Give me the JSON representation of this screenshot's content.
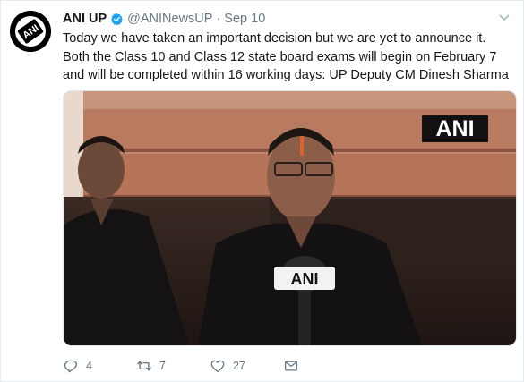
{
  "author": {
    "name": "ANI UP",
    "handle": "@ANINewsUP",
    "time": "Sep 10",
    "separator": "·"
  },
  "tweet": {
    "text": "Today we have taken an important decision but we are yet to announce it. Both the Class 10 and Class 12 state board exams will begin on February 7 and will be completed within 16 working days: UP Deputy CM Dinesh Sharma"
  },
  "media": {
    "watermark": "ANI",
    "mic_label": "ANI"
  },
  "actions": {
    "replies": "4",
    "retweets": "7",
    "likes": "27"
  },
  "icons": {
    "avatar": "ani-logo",
    "verified": "verified-badge-icon",
    "menu": "chevron-down-icon",
    "reply": "reply-icon",
    "retweet": "retweet-icon",
    "like": "heart-icon",
    "dm": "envelope-icon"
  },
  "colors": {
    "verified": "#1da1f2",
    "secondary_text": "#657786",
    "primary_text": "#14171a"
  }
}
